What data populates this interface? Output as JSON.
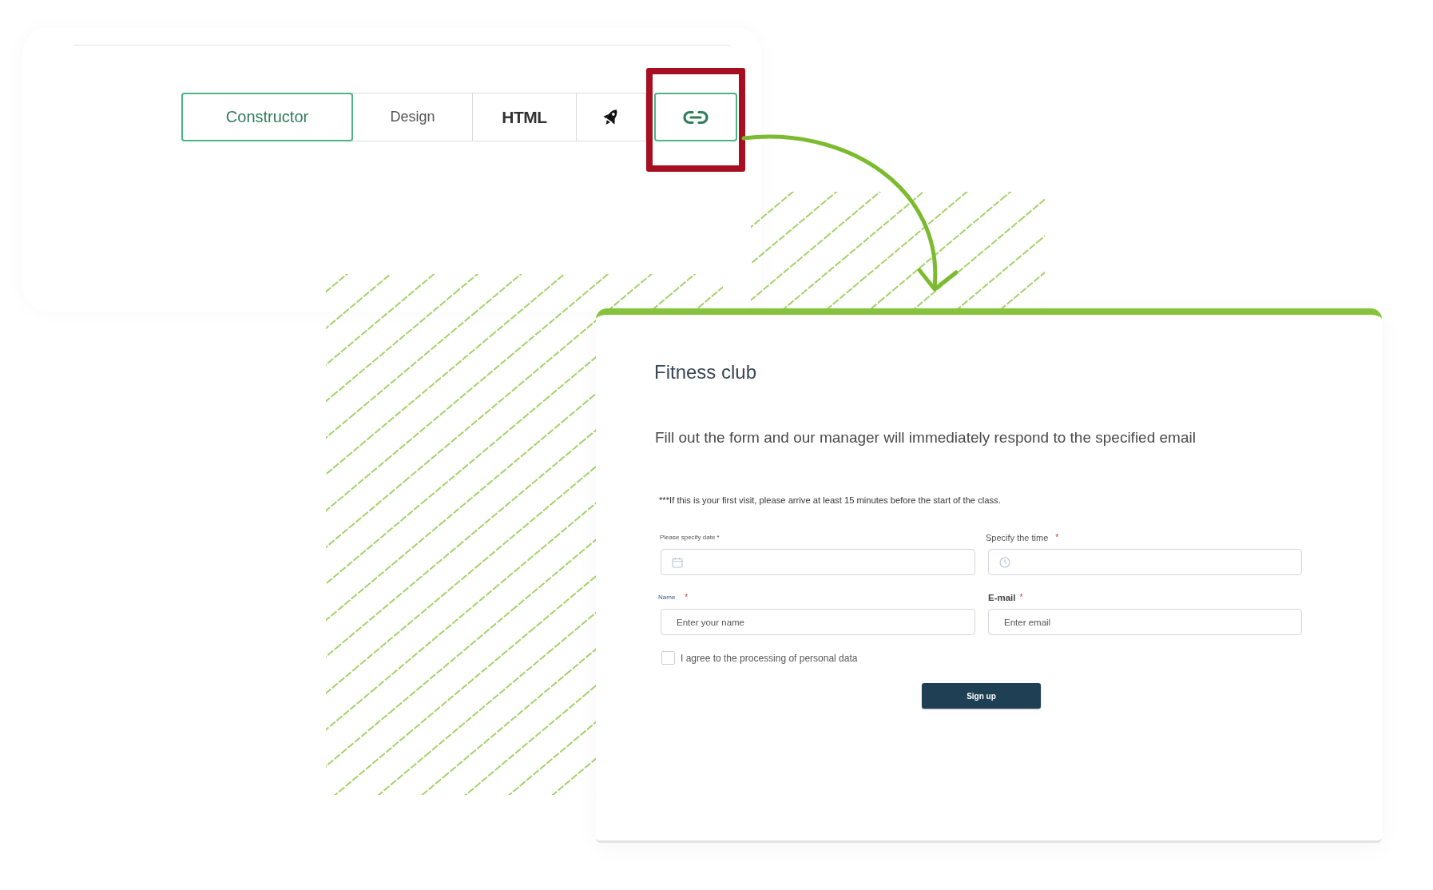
{
  "tabs": [
    {
      "kind": "text",
      "label": "Constructor",
      "selected": true,
      "highlighted": false
    },
    {
      "kind": "text",
      "label": "Design",
      "selected": false,
      "highlighted": false
    },
    {
      "kind": "text",
      "label": "HTML",
      "selected": false,
      "highlighted": false
    },
    {
      "kind": "icon",
      "selected": false,
      "highlighted": false
    },
    {
      "kind": "icon",
      "selected": true,
      "highlighted": true
    }
  ],
  "form": {
    "title": "Fitness club",
    "subtitle": "Fill out the form and our manager will immediately respond to the specified email",
    "note": "***If this is your first visit, please arrive at least 15 minutes before the start of the class.",
    "fields": [
      {
        "kind": "date",
        "label": "Please specify date *"
      },
      {
        "kind": "time",
        "label": "Specify the time",
        "required_mark": "*"
      },
      {
        "kind": "text",
        "label": "Name",
        "required_mark": "*",
        "placeholder": "Enter your name"
      },
      {
        "kind": "email",
        "label": "E-mail",
        "required_mark": "*",
        "placeholder": "Enter email"
      }
    ],
    "consent": {
      "label": "I agree to the processing of personal data",
      "checked": false
    },
    "submit": {
      "label": "Sign up"
    }
  }
}
